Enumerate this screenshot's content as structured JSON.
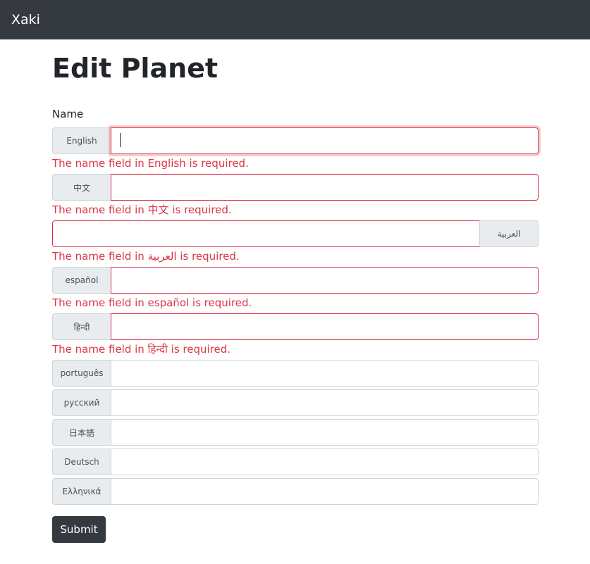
{
  "navbar": {
    "brand": "Xaki"
  },
  "page": {
    "title": "Edit Planet"
  },
  "form": {
    "label": "Name",
    "submit_label": "Submit",
    "fields": [
      {
        "language": "English",
        "value": "",
        "error": "The name field in English is required."
      },
      {
        "language": "中文",
        "value": "",
        "error": "The name field in 中文 is required."
      },
      {
        "language": "العربية",
        "value": "",
        "error": "The name field in العربية is required."
      },
      {
        "language": "español",
        "value": "",
        "error": "The name field in español is required."
      },
      {
        "language": "हिन्दी",
        "value": "",
        "error": "The name field in हिन्दी is required."
      },
      {
        "language": "português",
        "value": ""
      },
      {
        "language": "русский",
        "value": ""
      },
      {
        "language": "日本語",
        "value": ""
      },
      {
        "language": "Deutsch",
        "value": ""
      },
      {
        "language": "Ελληνικά",
        "value": ""
      }
    ]
  },
  "colors": {
    "navbar_bg": "#343a40",
    "error": "#dc3545",
    "addon_bg": "#e9ecef",
    "button_bg": "#343a40"
  }
}
